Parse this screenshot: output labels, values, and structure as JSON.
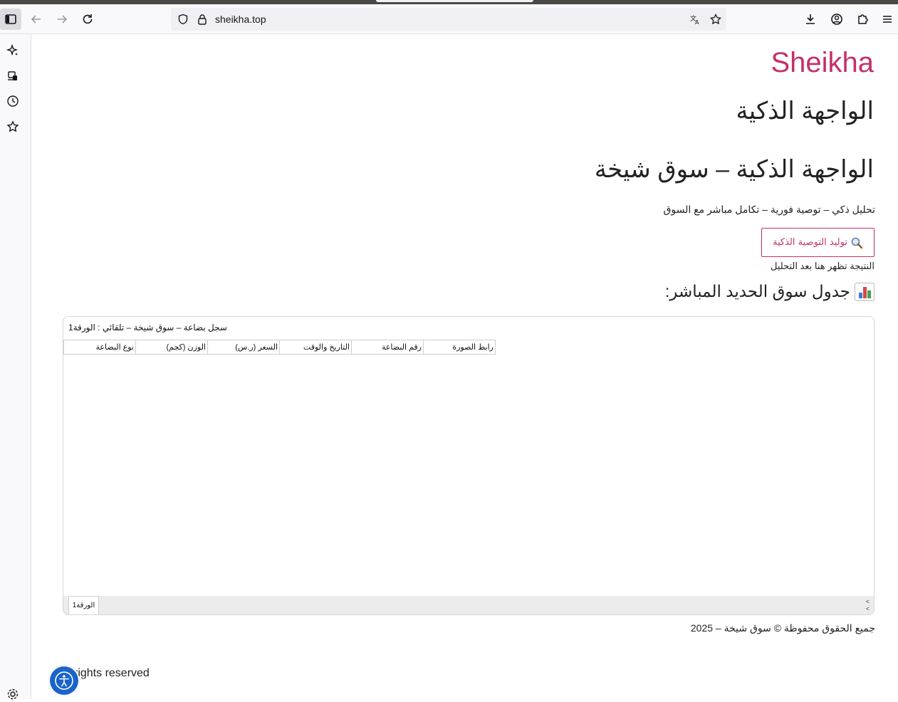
{
  "browser": {
    "url": "sheikha.top"
  },
  "page": {
    "brand": "Sheikha",
    "heading_main": "الواجهة الذكية",
    "heading_sub": "الواجهة الذكية – سوق شيخة",
    "tagline": "تحليل ذكي – توصية فورية – تكامل مباشر مع السوق",
    "generate_button_label": "توليد التوصية الذكية",
    "generate_button_icon": "magnifier-icon",
    "result_placeholder": "النتيجة تظهر هنا بعد التحليل",
    "table_title": "جدول سوق الحديد المباشر:",
    "footer_rights": "جميع الحقوق محفوظة © سوق شيخة – 2025",
    "footer_en": "rights reserved"
  },
  "sheet": {
    "title": "سجل بضاعة – سوق شيخة – تلقائي : الورقة1",
    "headers": [
      "نوع البضاعة",
      "الوزن (كجم)",
      "السعر (ر.س)",
      "التاريخ والوقت",
      "رقم البضاعة",
      "رابط الصورة"
    ],
    "tab_label": "الورقة1",
    "nav_labels": [
      "<",
      "<"
    ]
  },
  "colors": {
    "brand": "#c4306b",
    "accessibility_button": "#1a64c9"
  }
}
